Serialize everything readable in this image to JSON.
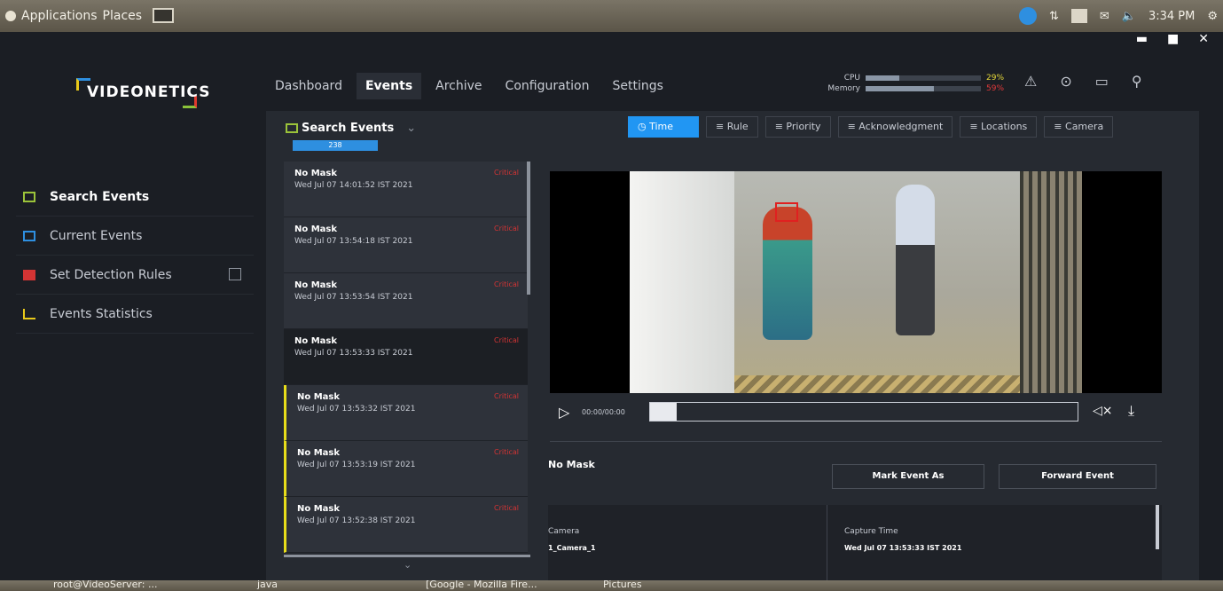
{
  "os": {
    "menu": [
      "Applications",
      "Places"
    ],
    "clock": "3:34 PM"
  },
  "app": {
    "logo": "VIDEONETICS",
    "nav": [
      {
        "label": "Dashboard",
        "active": false
      },
      {
        "label": "Events",
        "active": true
      },
      {
        "label": "Archive",
        "active": false
      },
      {
        "label": "Configuration",
        "active": false
      },
      {
        "label": "Settings",
        "active": false
      }
    ],
    "meters": [
      {
        "label": "CPU",
        "percent": 29,
        "text": "29%"
      },
      {
        "label": "Memory",
        "percent": 59,
        "text": "59%"
      }
    ]
  },
  "sidebar": {
    "items": [
      {
        "label": "Search Events",
        "icon": "search-events-icon",
        "active": true
      },
      {
        "label": "Current Events",
        "icon": "current-events-icon",
        "active": false
      },
      {
        "label": "Set Detection Rules",
        "icon": "detection-rules-icon",
        "active": false
      },
      {
        "label": "Events Statistics",
        "icon": "statistics-icon",
        "active": false
      }
    ]
  },
  "search": {
    "title": "Search Events",
    "count": "238",
    "filters": [
      "Time",
      "Rule",
      "Priority",
      "Acknowledgment",
      "Locations",
      "Camera"
    ]
  },
  "events": [
    {
      "title": "No Mask",
      "date": "Wed Jul 07 14:01:52 IST 2021",
      "severity": "Critical",
      "flag": false,
      "selected": false
    },
    {
      "title": "No Mask",
      "date": "Wed Jul 07 13:54:18 IST 2021",
      "severity": "Critical",
      "flag": false,
      "selected": false
    },
    {
      "title": "No Mask",
      "date": "Wed Jul 07 13:53:54 IST 2021",
      "severity": "Critical",
      "flag": false,
      "selected": false
    },
    {
      "title": "No Mask",
      "date": "Wed Jul 07 13:53:33 IST 2021",
      "severity": "Critical",
      "flag": false,
      "selected": true
    },
    {
      "title": "No Mask",
      "date": "Wed Jul 07 13:53:32 IST 2021",
      "severity": "Critical",
      "flag": true,
      "selected": false
    },
    {
      "title": "No Mask",
      "date": "Wed Jul 07 13:53:19 IST 2021",
      "severity": "Critical",
      "flag": true,
      "selected": false
    },
    {
      "title": "No Mask",
      "date": "Wed Jul 07 13:52:38 IST 2021",
      "severity": "Critical",
      "flag": true,
      "selected": false
    }
  ],
  "player": {
    "time": "00:00/00:00"
  },
  "detail": {
    "event_name": "No Mask",
    "mark_label": "Mark Event As",
    "forward_label": "Forward Event",
    "camera_label": "Camera",
    "camera_value": "1_Camera_1",
    "capture_label": "Capture Time",
    "capture_value": "Wed Jul 07 13:53:33 IST 2021"
  },
  "taskbar": [
    "root@VideoServer: ...",
    "java",
    "[Google - Mozilla Fire...",
    "Pictures"
  ],
  "colors": {
    "accent": "#2196f3",
    "critical": "#d43434",
    "flag": "#e8dd1a"
  }
}
